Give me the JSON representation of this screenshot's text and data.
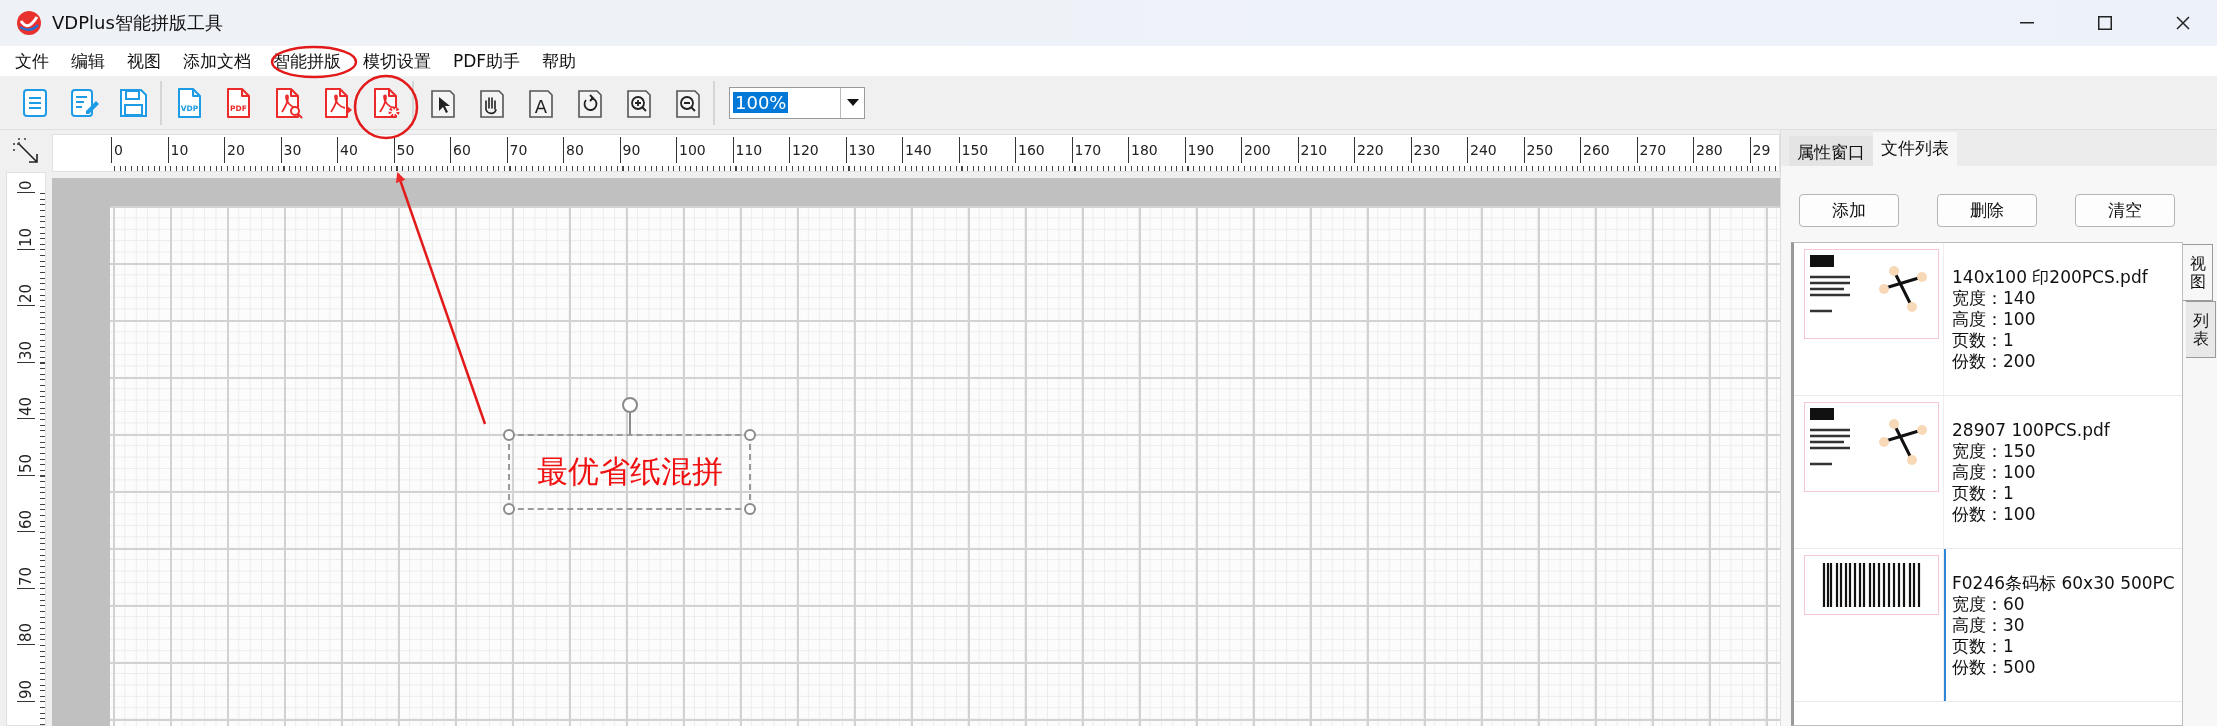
{
  "window": {
    "title": "VDPlus智能拼版工具"
  },
  "menu": [
    "文件",
    "编辑",
    "视图",
    "添加文档",
    "智能拼版",
    "模切设置",
    "PDF助手",
    "帮助"
  ],
  "toolbar": {
    "groups": [
      [
        {
          "kind": "document"
        },
        {
          "kind": "edit"
        },
        {
          "kind": "save"
        }
      ],
      [
        {
          "kind": "vdp",
          "label": "VDP"
        },
        {
          "kind": "pdf",
          "label": "PDF"
        },
        {
          "kind": "pdf-search"
        },
        {
          "kind": "pdf-play"
        },
        {
          "kind": "pdf-settings"
        }
      ],
      [
        {
          "kind": "pointer"
        },
        {
          "kind": "hand"
        },
        {
          "kind": "text",
          "label": "A"
        },
        {
          "kind": "rotate"
        },
        {
          "kind": "zoom-in"
        },
        {
          "kind": "zoom-out"
        }
      ]
    ],
    "zoom": {
      "value": "100%"
    }
  },
  "ruler": {
    "horizontal": [
      "0",
      "10",
      "20",
      "30",
      "40",
      "50",
      "60",
      "70",
      "80",
      "90",
      "100",
      "110",
      "120",
      "130",
      "140",
      "150",
      "160",
      "170",
      "180",
      "190",
      "200",
      "210",
      "220",
      "230",
      "240",
      "250",
      "260",
      "270",
      "280",
      "29"
    ],
    "vertical": [
      "0",
      "10",
      "20",
      "30",
      "40",
      "50",
      "60",
      "70",
      "80",
      "90"
    ]
  },
  "canvas": {
    "text": "最优省纸混拼"
  },
  "panel": {
    "tabs": [
      {
        "label": "属性窗口",
        "selected": false
      },
      {
        "label": "文件列表",
        "selected": true
      }
    ],
    "buttons": [
      "添加",
      "删除",
      "清空"
    ],
    "files": [
      {
        "kind": "label",
        "name": "140x100 印200PCS.pdf",
        "details": [
          "宽度：140",
          "高度：100",
          "页数：1",
          "份数：200"
        ],
        "selected": false
      },
      {
        "kind": "label",
        "name": "28907 100PCS.pdf",
        "details": [
          "宽度：150",
          "高度：100",
          "页数：1",
          "份数：100"
        ],
        "selected": false
      },
      {
        "kind": "barcode",
        "name": "F0246条码标 60x30 500PC",
        "details": [
          "宽度：60",
          "高度：30",
          "页数：1",
          "份数：500"
        ],
        "selected": true
      }
    ],
    "side_tabs": [
      {
        "label": "视图",
        "selected": true
      },
      {
        "label": "列表",
        "selected": false
      }
    ]
  }
}
